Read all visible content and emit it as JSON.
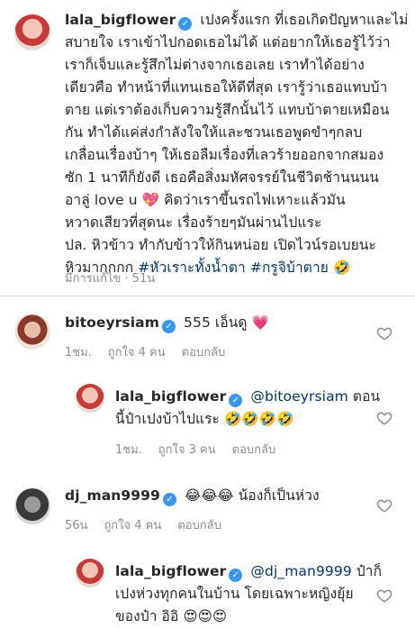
{
  "post": {
    "username": "lala_bigflower",
    "lines": [
      "เปงครั้งแรก ที่เธอเกิดปัญหาและไม่",
      "สบายใจ เราเข้าไปกอดเธอไม่ได้ แต่อยากให้เธอรู้ไว้ว่า",
      "เราก็เจ็บและรู้สึกไม่ต่างจากเธอเลย เราทำได้อย่าง",
      "เดียวคือ ทำหน้าที่แทนเธอให้ดีที่สุด เรารู้ว่าเธอแทบบ้า",
      "ตาย แต่เราต้องเก็บความรู้สึกนั้นไว้ แทบบ้าตายเหมือน",
      "กัน ทำได้แค่ส่งกำลังใจให้และชวนเธอพูดขำๆกลบ",
      "เกลื่อนเรื่องบ้าๆ ให้เธอลืมเรื่องที่เลวร้ายออกจากสมอง",
      "ซัก 1 นาทีก็ยังดี เธอคือสิ่งมหัศจรรย์ในชีวิตช้านนนน",
      "อาลู่ love u 💖 คิดว่าเราขึ้นรถไฟเหาะแล้วมัน",
      "หวาดเสียวที่สุดนะ เรื่องร้ายๆมันผ่านไปแระ",
      "ปล. หิวข้าว ทำกับข้าวให้กินหน่อย เปิดไวน์รอเบยนะ"
    ],
    "last_line_prefix": "หิวมากกกก ",
    "hashtags": "#หัวเราะทั้งน้ำตา #กรูจิบ้าตาย",
    "last_emoji": "🤣",
    "meta": "มีการแก้ไข · 51น"
  },
  "comments": [
    {
      "username": "bitoeyrsiam",
      "text": "555 เอ็นดู 💗",
      "time": "1ชม.",
      "likes": "ถูกใจ 4 คน",
      "reply": "ตอบกลับ"
    },
    {
      "username": "lala_bigflower",
      "mention": "@bitoeyrsiam",
      "text_a": " ตอน",
      "text_b": "นี้ป๋าเปงบ้าไปแระ 🤣🤣🤣🤣",
      "time": "1ชม.",
      "likes": "ถูกใจ 3 คน",
      "reply": "ตอบกลับ"
    },
    {
      "username": "dj_man9999",
      "text": "😂😂😂 น้องก็เป็นห่วง",
      "time": "56น",
      "likes": "ถูกใจ 4 คน",
      "reply": "ตอบกลับ"
    },
    {
      "username": "lala_bigflower",
      "mention": "@dj_man9999",
      "text_a": " ป๋าก็",
      "text_b": "เปงห่วงทุกคนในบ้าน โดยเฉพาะหญิงยุ้ย",
      "text_c": "ของป๋า อิอิ 😍😍😍"
    }
  ],
  "verified_glyph": "✓",
  "colors": {
    "verified": "#3897f0",
    "link": "#00376b",
    "meta": "#8e8e8e"
  }
}
